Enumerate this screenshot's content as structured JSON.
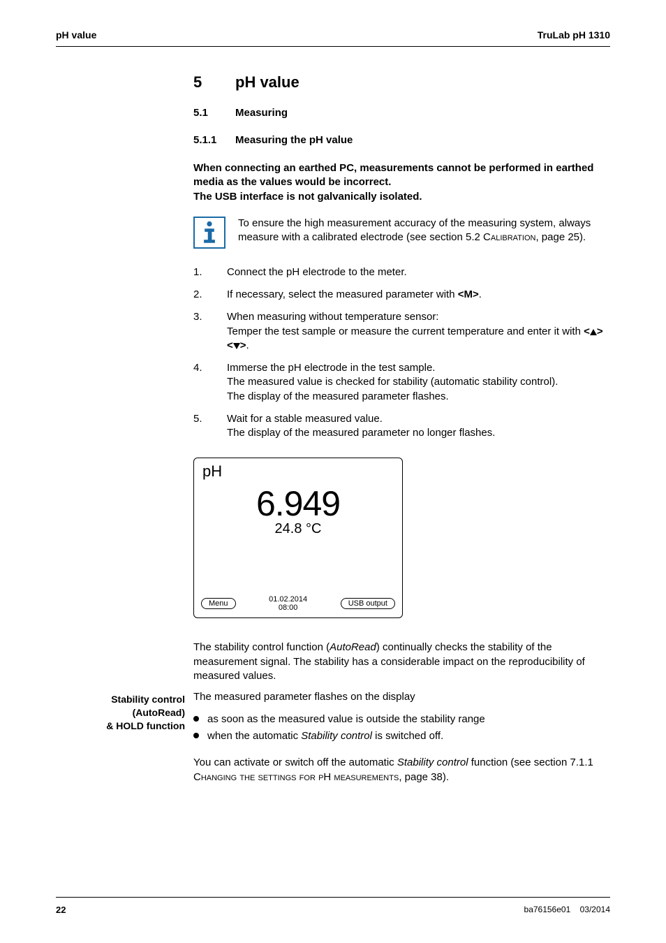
{
  "header": {
    "left": "pH value",
    "right": "TruLab pH 1310"
  },
  "h1": {
    "num": "5",
    "title": "pH value"
  },
  "h2": {
    "num": "5.1",
    "title": "Measuring"
  },
  "h3": {
    "num": "5.1.1",
    "title": "Measuring the pH value"
  },
  "warning": {
    "line1": "When connecting an earthed PC, measurements cannot be performed in earthed media as the values would be incorrect.",
    "line2": "The USB interface is not galvanically isolated."
  },
  "info": {
    "pre": "To ensure the high measurement accuracy of the measuring system, always measure with a calibrated electrode (see section 5.2 ",
    "caps": "Calibration",
    "post": ", page 25)."
  },
  "steps": {
    "s1": "Connect the pH electrode to the meter.",
    "s2_pre": "If necessary, select the measured parameter with ",
    "s2_key": "<M>",
    "s2_post": ".",
    "s3_l1": "When measuring without temperature sensor:",
    "s3_l2_pre": "Temper the test sample or measure the current temperature and enter it with ",
    "s3_key_open1": "<",
    "s3_key_close1": ">",
    "s3_key_open2": " <",
    "s3_key_close2": ">",
    "s3_l2_post": ".",
    "s4_l1": "Immerse the pH electrode in the test sample.",
    "s4_l2": "The measured value is checked for stability (automatic stability control).",
    "s4_l3": "The display of the measured parameter flashes.",
    "s5_l1": "Wait for a stable measured value.",
    "s5_l2": "The display of the measured parameter no longer flashes."
  },
  "display": {
    "label": "pH",
    "value": "6.949",
    "temp": "24.8 °C",
    "softkey_left": "Menu",
    "date": "01.02.2014",
    "time": "08:00",
    "softkey_right": "USB output"
  },
  "side": {
    "l1": "Stability control",
    "l2": "(AutoRead)",
    "l3": "& HOLD function"
  },
  "stability": {
    "p1_pre": "The stability control function (",
    "p1_it": "AutoRead",
    "p1_post": ") continually checks the stability of the measurement signal. The stability has a considerable impact on the reproducibility of measured values.",
    "p2": "The measured parameter flashes on the display",
    "b1": "as soon as the measured value is outside the stability range",
    "b2_pre": "when the automatic ",
    "b2_it": "Stability control",
    "b2_post": " is switched off.",
    "p3_pre": "You can activate or switch off the automatic ",
    "p3_it": "Stability control",
    "p3_mid": " function (see section 7.1.1 ",
    "p3_caps": "Changing the settings for pH measurements",
    "p3_post": ", page 38)."
  },
  "footer": {
    "page": "22",
    "doc": "ba76156e01",
    "date": "03/2014"
  }
}
